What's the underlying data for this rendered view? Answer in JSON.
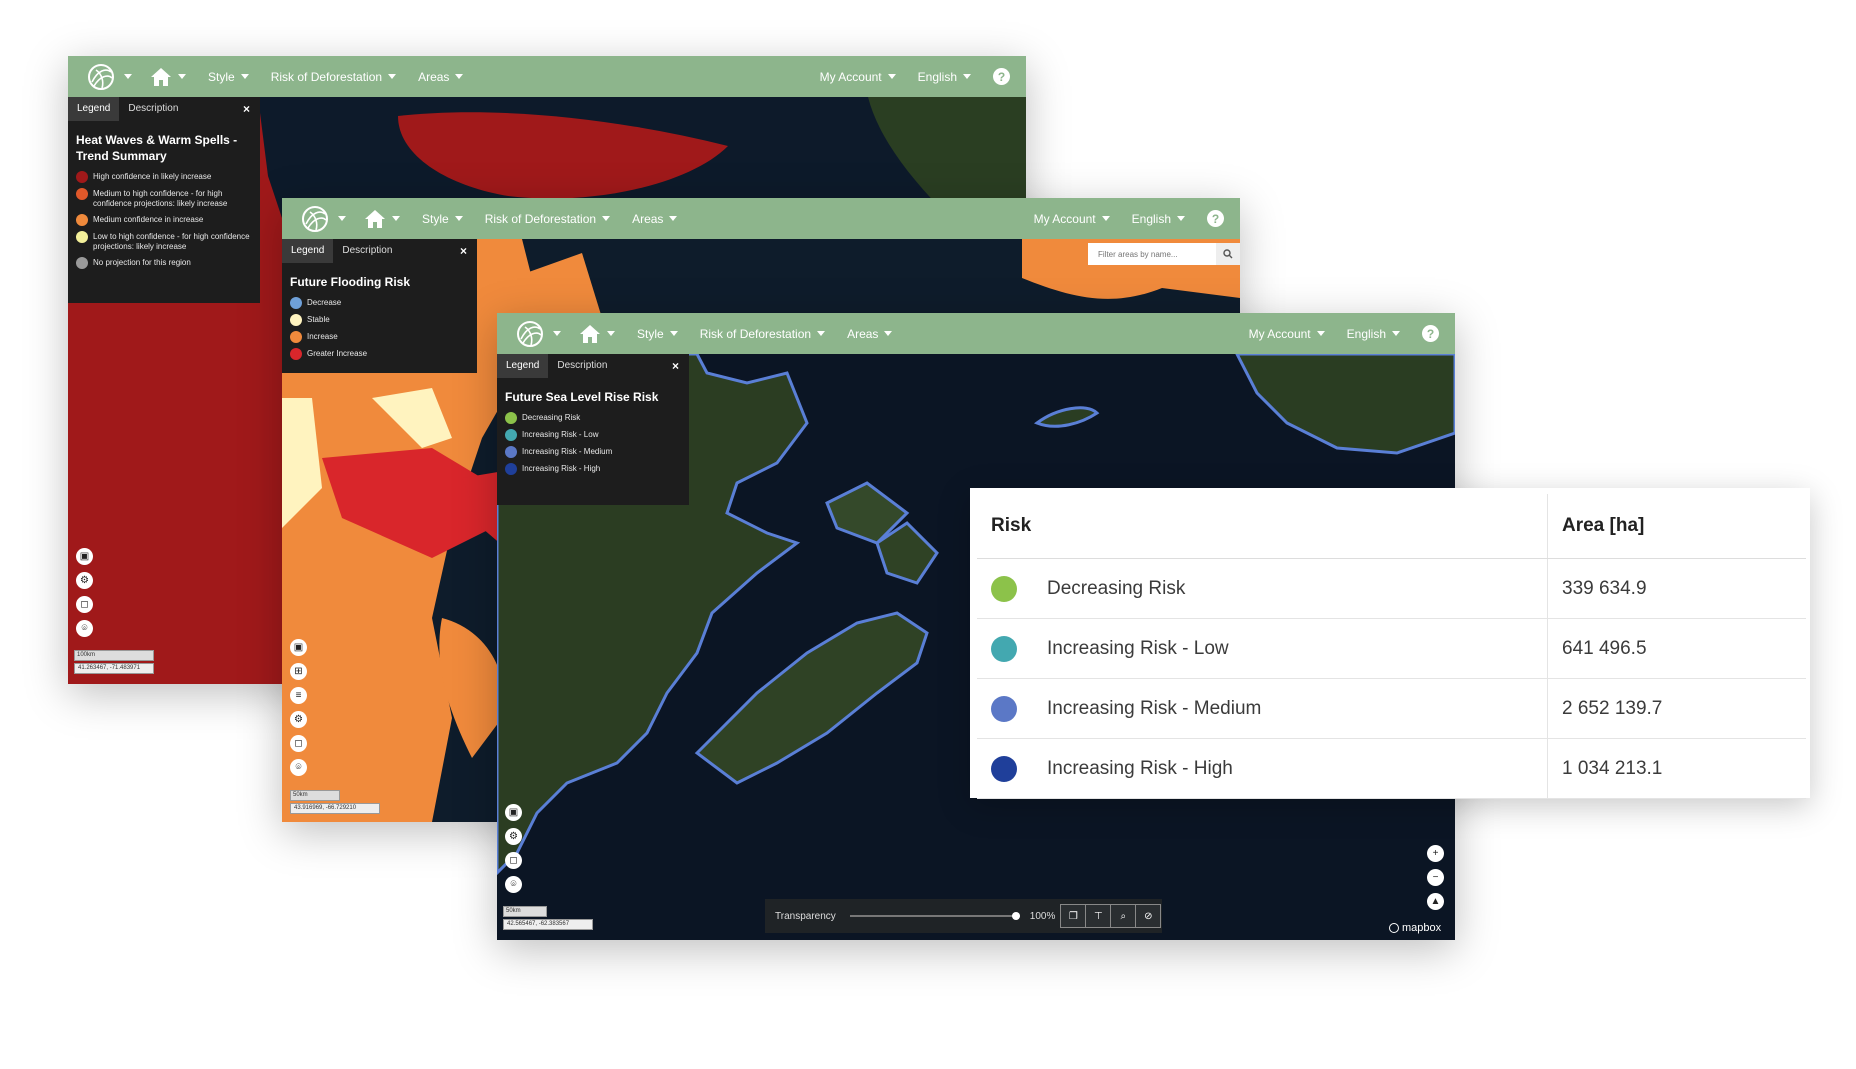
{
  "nav": {
    "style": "Style",
    "deforestation": "Risk of Deforestation",
    "areas": "Areas",
    "account": "My Account",
    "language": "English",
    "help": "?"
  },
  "legend_tabs": {
    "legend": "Legend",
    "description": "Description",
    "close": "×"
  },
  "windows": [
    {
      "legend_title": "Heat Waves & Warm Spells - Trend Summary",
      "items": [
        {
          "label": "High confidence in likely increase",
          "color": "#a0191a"
        },
        {
          "label": "Medium to high confidence - for high confidence projections: likely increase",
          "color": "#e0582a"
        },
        {
          "label": "Medium confidence in increase",
          "color": "#f08a3c"
        },
        {
          "label": "Low to high confidence - for high confidence projections: likely increase",
          "color": "#f3ef9a"
        },
        {
          "label": "No projection for this region",
          "color": "#9a9a9a"
        }
      ],
      "scale": "100km",
      "coords": "41.263467, -71.483971"
    },
    {
      "legend_title": "Future Flooding Risk",
      "items": [
        {
          "label": "Decrease",
          "color": "#6fa0d8"
        },
        {
          "label": "Stable",
          "color": "#fff3bf"
        },
        {
          "label": "Increase",
          "color": "#f08a3c"
        },
        {
          "label": "Greater Increase",
          "color": "#d9262b"
        }
      ],
      "scale": "50km",
      "coords": "43.916969, -66.729210",
      "search_placeholder": "Filter areas by name..."
    },
    {
      "legend_title": "Future Sea Level Rise Risk",
      "items": [
        {
          "label": "Decreasing Risk",
          "color": "#8cc24a"
        },
        {
          "label": "Increasing Risk - Low",
          "color": "#43a8b0"
        },
        {
          "label": "Increasing Risk - Medium",
          "color": "#5b78c6"
        },
        {
          "label": "Increasing Risk - High",
          "color": "#1f3f9a"
        }
      ],
      "scale": "50km",
      "coords": "42.565467, -62.383567",
      "transparency_label": "Transparency",
      "transparency_value": "100%",
      "transparency_fraction": 1.0,
      "attribution": "mapbox"
    }
  ],
  "table": {
    "headers": [
      "Risk",
      "Area [ha]"
    ],
    "rows": [
      {
        "risk": "Decreasing Risk",
        "area": "339 634.9",
        "color": "#8cc24a"
      },
      {
        "risk": "Increasing Risk - Low",
        "area": "641 496.5",
        "color": "#43a8b0"
      },
      {
        "risk": "Increasing Risk - Medium",
        "area": "2 652 139.7",
        "color": "#5b78c6"
      },
      {
        "risk": "Increasing Risk - High",
        "area": "1 034 213.1",
        "color": "#1f3f9a"
      }
    ]
  }
}
